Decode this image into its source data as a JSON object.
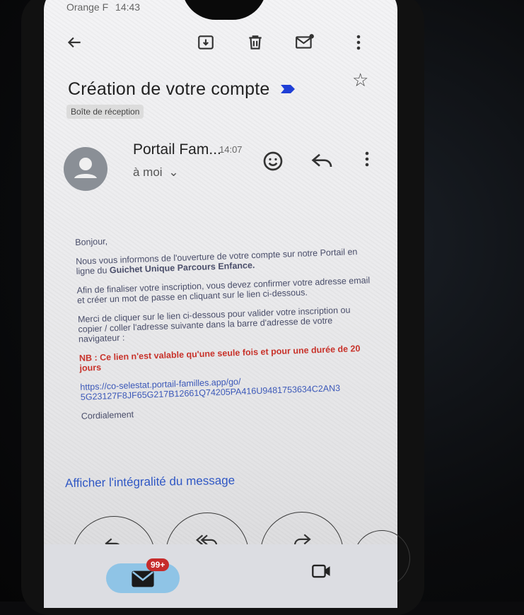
{
  "status_bar": {
    "carrier": "Orange F",
    "time": "14:43"
  },
  "toolbar": {
    "back_icon": "back-arrow-icon",
    "archive_icon": "archive-icon",
    "delete_icon": "trash-icon",
    "unread_icon": "mark-unread-icon",
    "more_icon": "more-vert-icon"
  },
  "email": {
    "subject": "Création de votre compte",
    "label": "Boîte de réception",
    "sender": "Portail Fam...",
    "time": "14:07",
    "recipient": "à moi",
    "body": {
      "greeting": "Bonjour,",
      "p1_prefix": "Nous vous informons de l'ouverture de votre compte sur notre Portail en ligne du ",
      "p1_bold": "Guichet Unique Parcours Enfance.",
      "p2": "Afin de finaliser votre inscription, vous devez confirmer votre adresse email et créer un mot de passe en cliquant sur le lien ci-dessous.",
      "p3": "Merci de cliquer sur le lien ci-dessous pour valider votre inscription ou copier / coller l'adresse suivante dans la barre d'adresse de votre navigateur :",
      "warning": "NB : Ce lien n'est valable qu'une seule fois et pour une durée de 20 jours",
      "link": "https://co-selestat.portail-familles.app/go/ 5G23127F8JF65G217B12661Q74205PA416U9481753634C2AN3",
      "closing": "Cordialement"
    },
    "show_full": "Afficher l'intégralité du message"
  },
  "bottom_nav": {
    "mail_badge": "99+"
  }
}
